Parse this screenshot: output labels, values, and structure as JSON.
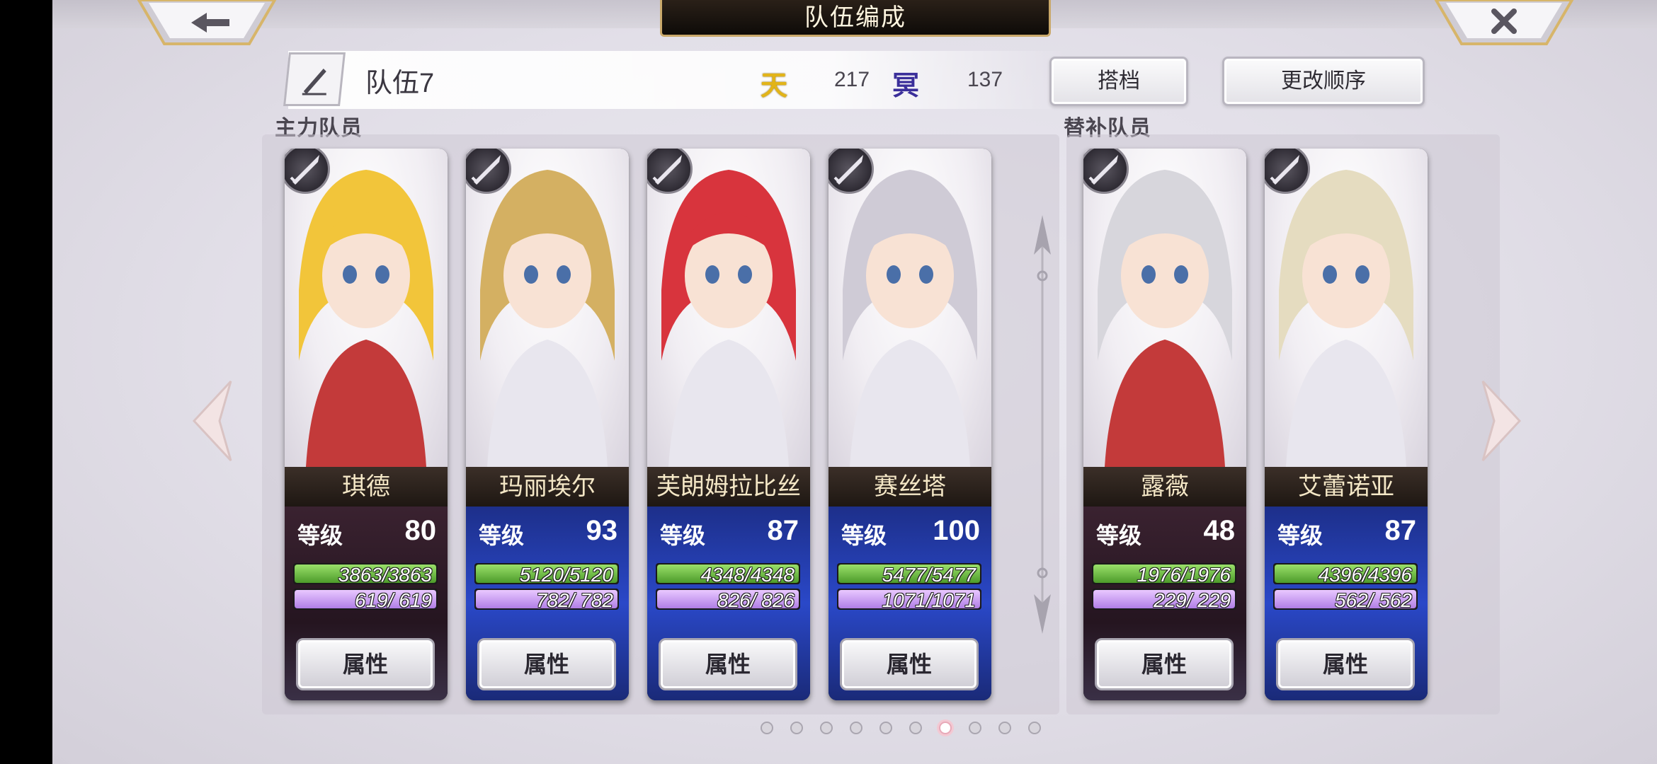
{
  "header": {
    "title": "队伍编成",
    "back_icon": "back-arrow-icon",
    "close_icon": "close-icon"
  },
  "team": {
    "name": "队伍7",
    "stat_a": {
      "icon_text": "天",
      "value": "217",
      "color": "#e2b418"
    },
    "stat_b": {
      "icon_text": "冥",
      "value": "137",
      "color": "#3b2f9a"
    },
    "partner_label": "搭档",
    "reorder_label": "更改顺序"
  },
  "sections": {
    "main_label": "主力队员",
    "sub_label": "替补队员"
  },
  "main_members": [
    {
      "name": "琪德",
      "level_label": "等级",
      "level": "80",
      "hp": "3863/3863",
      "mp": "619/ 619",
      "hp_frac": 1.0,
      "mp_frac": 1.0,
      "attr_label": "属性",
      "weapon_icon": "sword-icon",
      "theme": "red"
    },
    {
      "name": "玛丽埃尔",
      "level_label": "等级",
      "level": "93",
      "hp": "5120/5120",
      "mp": "782/ 782",
      "hp_frac": 1.0,
      "mp_frac": 1.0,
      "attr_label": "属性",
      "weapon_icon": "whip-icon",
      "theme": "blue"
    },
    {
      "name": "芙朗姆拉比丝",
      "level_label": "等级",
      "level": "87",
      "hp": "4348/4348",
      "mp": "826/ 826",
      "hp_frac": 1.0,
      "mp_frac": 1.0,
      "attr_label": "属性",
      "weapon_icon": "sword-icon",
      "theme": "blue"
    },
    {
      "name": "赛丝塔",
      "level_label": "等级",
      "level": "100",
      "hp": "5477/5477",
      "mp": "1071/1071",
      "hp_frac": 1.0,
      "mp_frac": 1.0,
      "attr_label": "属性",
      "weapon_icon": "sword-icon",
      "theme": "blue"
    }
  ],
  "sub_members": [
    {
      "name": "露薇",
      "level_label": "等级",
      "level": "48",
      "hp": "1976/1976",
      "mp": "229/ 229",
      "hp_frac": 1.0,
      "mp_frac": 1.0,
      "attr_label": "属性",
      "weapon_icon": "sword-icon",
      "theme": "red"
    },
    {
      "name": "艾蕾诺亚",
      "level_label": "等级",
      "level": "87",
      "hp": "4396/4396",
      "mp": "562/ 562",
      "hp_frac": 1.0,
      "mp_frac": 1.0,
      "attr_label": "属性",
      "weapon_icon": "sword-icon",
      "theme": "blue"
    }
  ],
  "pagination": {
    "total": 10,
    "active_index": 6
  },
  "icons": {
    "prev": "chevron-left-icon",
    "next": "chevron-right-icon",
    "edit": "quill-pen-icon",
    "swap": "vertical-swap-icon"
  }
}
